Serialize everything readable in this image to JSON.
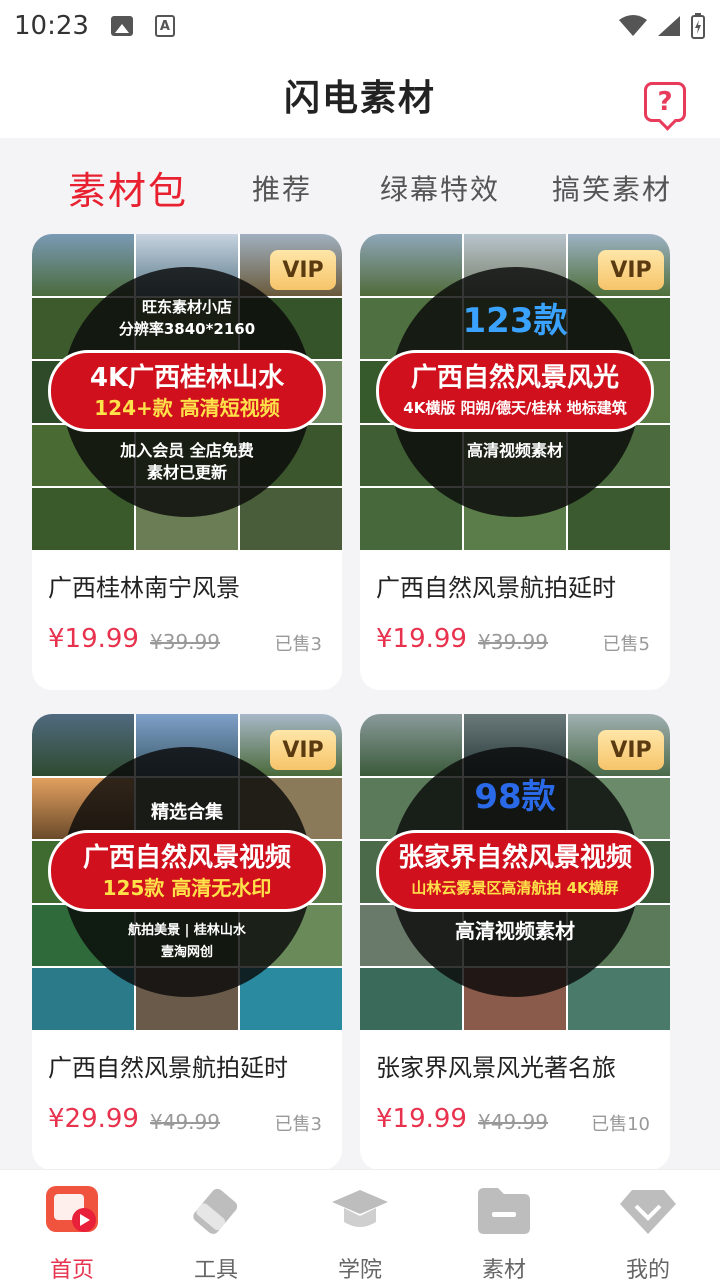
{
  "status_bar": {
    "time": "10:23"
  },
  "header": {
    "title": "闪电素材",
    "help_icon": "question-bubble-icon"
  },
  "tabs": [
    {
      "label": "素材包",
      "active": true
    },
    {
      "label": "推荐"
    },
    {
      "label": "绿幕特效"
    },
    {
      "label": "搞笑素材"
    }
  ],
  "cards": [
    {
      "badge": "VIP",
      "thumb_top": "旺东素材小店\n分辨率3840*2160",
      "thumb_main": "4K广西桂林山水",
      "thumb_sub": "124+款 高清短视频",
      "thumb_bottom": "加入会员 全店免费\n素材已更新",
      "title": "广西桂林南宁风景",
      "price": "¥19.99",
      "original_price": "¥39.99",
      "sold": "已售3"
    },
    {
      "badge": "VIP",
      "thumb_top": "123款",
      "thumb_main": "广西自然风景风光",
      "thumb_sub": "4K横版 阳朔/德天/桂林 地标建筑",
      "thumb_bottom": "高清视频素材",
      "title": "广西自然风景航拍延时",
      "price": "¥19.99",
      "original_price": "¥39.99",
      "sold": "已售5"
    },
    {
      "badge": "VIP",
      "thumb_top": "精选合集",
      "thumb_main": "广西自然风景视频",
      "thumb_sub": "125款 高清无水印",
      "thumb_bottom": "航拍美景 | 桂林山水\n壹淘网创",
      "title": "广西自然风景航拍延时",
      "price": "¥29.99",
      "original_price": "¥49.99",
      "sold": "已售3"
    },
    {
      "badge": "VIP",
      "thumb_top": "98款",
      "thumb_main": "张家界自然风景视频",
      "thumb_sub": "山林云雾景区高清航拍 4K横屏",
      "thumb_bottom": "高清视频素材",
      "title": "张家界风景风光著名旅",
      "price": "¥19.99",
      "original_price": "¥49.99",
      "sold": "已售10"
    }
  ],
  "bottom_nav": [
    {
      "label": "首页",
      "icon": "home-play-icon",
      "active": true
    },
    {
      "label": "工具",
      "icon": "eraser-icon"
    },
    {
      "label": "学院",
      "icon": "graduation-cap-icon"
    },
    {
      "label": "素材",
      "icon": "folder-icon"
    },
    {
      "label": "我的",
      "icon": "diamond-icon"
    }
  ],
  "colors": {
    "accent": "#e8202f",
    "price": "#e8334f",
    "vip_gold": "#f6c46a"
  }
}
